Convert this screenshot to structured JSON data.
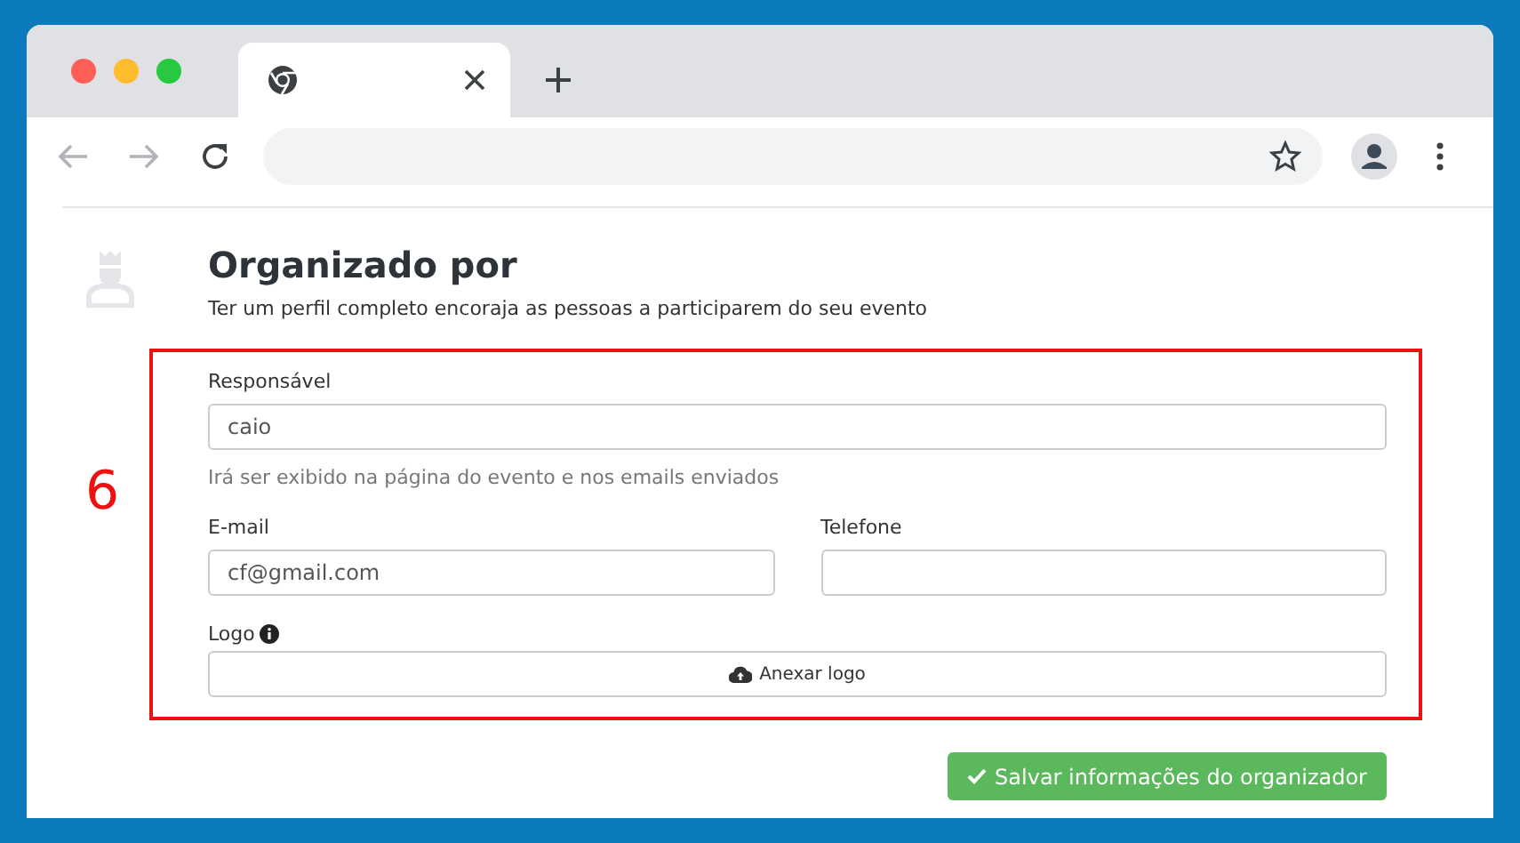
{
  "annotation": "6",
  "section": {
    "title": "Organizado por",
    "subtitle": "Ter um perfil completo encoraja as pessoas a participarem do seu evento"
  },
  "rows": [
    [
      {
        "kind": "text",
        "label": "Responsável",
        "value": "caio",
        "hint": "Irá ser exibido na página do evento e nos emails enviados"
      }
    ],
    [
      {
        "kind": "text",
        "label": "E-mail",
        "value": "cf@gmail.com"
      },
      {
        "kind": "text",
        "label": "Telefone"
      }
    ],
    [
      {
        "kind": "file",
        "label": "Logo",
        "info": true,
        "button": "Anexar logo"
      }
    ]
  ],
  "save_button": "Salvar informações do organizador"
}
